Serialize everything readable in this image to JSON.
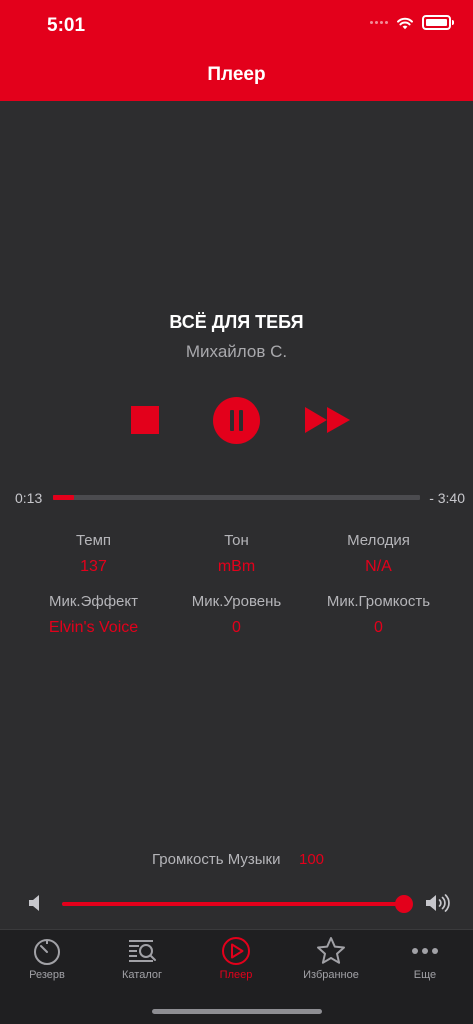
{
  "status_bar": {
    "time": "5:01"
  },
  "nav": {
    "title": "Плеер"
  },
  "track": {
    "title": "ВСЁ ДЛЯ ТЕБЯ",
    "artist": "Михайлов С."
  },
  "playback": {
    "elapsed": "0:13",
    "remaining": "- 3:40",
    "progress_fraction": 0.058
  },
  "stats": [
    {
      "label": "Темп",
      "value": "137"
    },
    {
      "label": "Тон",
      "value": "mBm"
    },
    {
      "label": "Мелодия",
      "value": "N/A"
    },
    {
      "label": "Мик.Эффект",
      "value": "Elvin's Voice"
    },
    {
      "label": "Мик.Уровень",
      "value": "0"
    },
    {
      "label": "Мик.Громкость",
      "value": "0"
    }
  ],
  "volume": {
    "label": "Громкость Музыки",
    "value": "100",
    "level_fraction": 1.0
  },
  "tabs": [
    {
      "label": "Резерв",
      "icon": "timer-icon",
      "active": false
    },
    {
      "label": "Каталог",
      "icon": "catalog-search-icon",
      "active": false
    },
    {
      "label": "Плеер",
      "icon": "play-circle-icon",
      "active": true
    },
    {
      "label": "Избранное",
      "icon": "star-icon",
      "active": false
    },
    {
      "label": "Еще",
      "icon": "more-dots-icon",
      "active": false
    }
  ],
  "colors": {
    "accent": "#e3001b",
    "background": "#2d2d2f",
    "tabbar": "#1f1f21",
    "muted_text": "#b5b5b9"
  }
}
